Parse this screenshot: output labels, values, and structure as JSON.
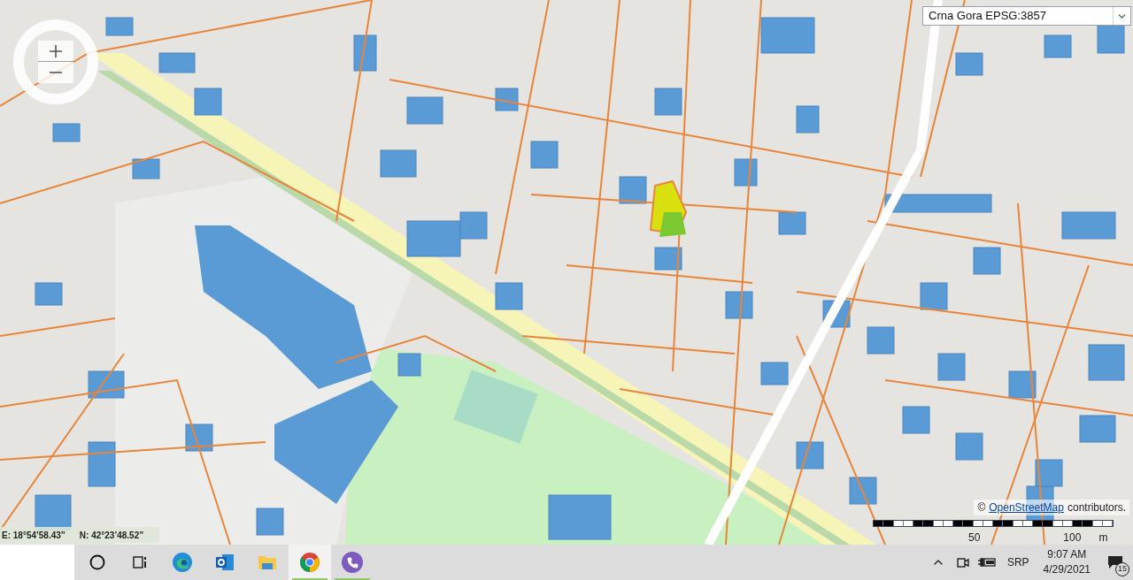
{
  "projection_select": {
    "value": "Crna Gora EPSG:3857"
  },
  "attribution": {
    "symbol": "©",
    "link": "OpenStreetMap",
    "text": "contributors."
  },
  "scale_bar": {
    "labels": [
      "50",
      "100"
    ],
    "unit": "m"
  },
  "coordinates": {
    "east": "E: 18°54’58.43”",
    "north": "N: 42°23’48.52”"
  },
  "taskbar": {
    "apps": [
      {
        "kind": "cortana",
        "selected": false,
        "running": false
      },
      {
        "kind": "task-view",
        "selected": false,
        "running": false
      },
      {
        "kind": "edge",
        "selected": false,
        "running": false
      },
      {
        "kind": "outlook",
        "selected": false,
        "running": false
      },
      {
        "kind": "explorer",
        "selected": false,
        "running": false
      },
      {
        "kind": "chrome",
        "selected": true,
        "running": true
      },
      {
        "kind": "viber",
        "selected": false,
        "running": true
      }
    ],
    "tray": {
      "language": "SRP",
      "time": "9:07 AM",
      "date": "4/29/2021",
      "notifications": "15"
    }
  }
}
